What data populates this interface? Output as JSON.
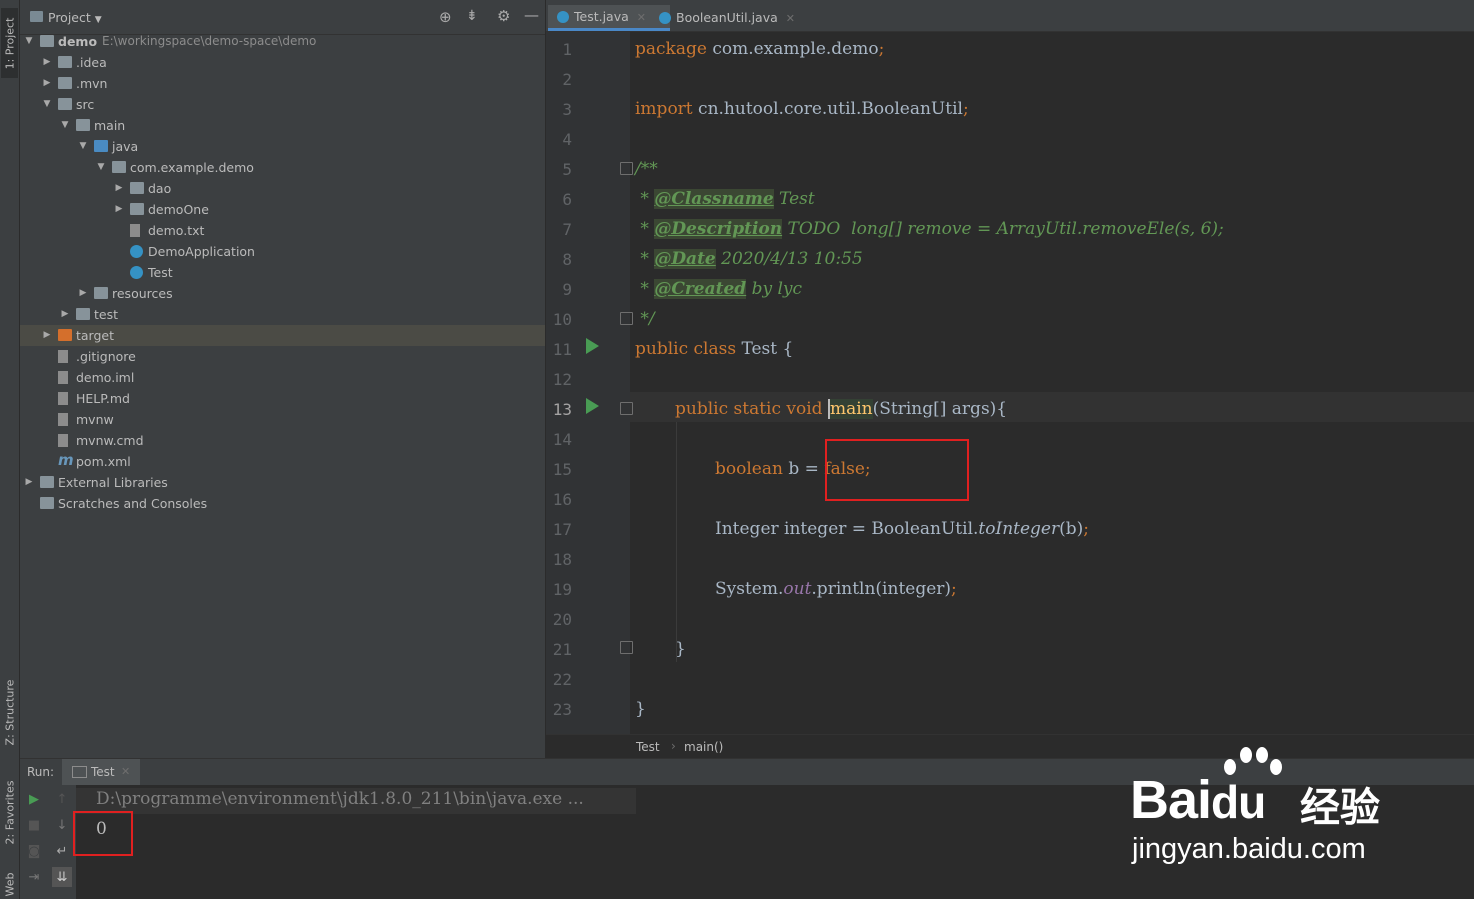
{
  "left_stripe": {
    "project_tab": "1: Project",
    "structure_tab": "Z: Structure",
    "favorites_tab": "2: Favorites",
    "web_tab": "Web"
  },
  "project_panel": {
    "title": "Project",
    "tree": [
      {
        "label": "demo",
        "path": "E:\\workingspace\\demo-space\\demo",
        "icon": "folder-icon"
      },
      {
        "label": ".idea",
        "icon": "folder-icon"
      },
      {
        "label": ".mvn",
        "icon": "folder-icon"
      },
      {
        "label": "src",
        "icon": "folder-icon"
      },
      {
        "label": "main",
        "icon": "folder-icon"
      },
      {
        "label": "java",
        "icon": "source-folder-icon"
      },
      {
        "label": "com.example.demo",
        "icon": "package-icon"
      },
      {
        "label": "dao",
        "icon": "package-icon"
      },
      {
        "label": "demoOne",
        "icon": "package-icon"
      },
      {
        "label": "demo.txt",
        "icon": "text-file-icon"
      },
      {
        "label": "DemoApplication",
        "icon": "class-icon"
      },
      {
        "label": "Test",
        "icon": "class-icon"
      },
      {
        "label": "resources",
        "icon": "resources-folder-icon"
      },
      {
        "label": "test",
        "icon": "folder-icon"
      },
      {
        "label": "target",
        "icon": "excluded-folder-icon"
      },
      {
        "label": ".gitignore",
        "icon": "text-file-icon"
      },
      {
        "label": "demo.iml",
        "icon": "module-file-icon"
      },
      {
        "label": "HELP.md",
        "icon": "markdown-file-icon"
      },
      {
        "label": "mvnw",
        "icon": "text-file-icon"
      },
      {
        "label": "mvnw.cmd",
        "icon": "text-file-icon"
      },
      {
        "label": "pom.xml",
        "icon": "maven-icon"
      },
      {
        "label": "External Libraries",
        "icon": "libraries-icon"
      },
      {
        "label": "Scratches and Consoles",
        "icon": "scratches-icon"
      }
    ]
  },
  "editor": {
    "tabs": [
      {
        "label": "Test.java"
      },
      {
        "label": "BooleanUtil.java"
      }
    ],
    "line_numbers": [
      "1",
      "2",
      "3",
      "4",
      "5",
      "6",
      "7",
      "8",
      "9",
      "10",
      "11",
      "12",
      "13",
      "14",
      "15",
      "16",
      "17",
      "18",
      "19",
      "20",
      "21",
      "22",
      "23"
    ],
    "code": {
      "l1_kw": "package",
      "l1_rest": " com.example.demo",
      "l1_semi": ";",
      "l3_kw": "import",
      "l3_rest": " cn.hutool.core.util.BooleanUtil",
      "l3_semi": ";",
      "l5": "/**",
      "l6_star": " * ",
      "l6_tag": "@Classname",
      "l6_rest": " Test",
      "l7_star": " * ",
      "l7_tag": "@Description",
      "l7_rest": " TODO  long[] remove = ArrayUtil.removeEle(s, 6);",
      "l8_star": " * ",
      "l8_tag": "@Date",
      "l8_rest": " 2020/4/13 10:55",
      "l9_star": " * ",
      "l9_tag": "@Created",
      "l9_rest": " by lyc",
      "l10": " */",
      "l11_kw": "public class",
      "l11_rest": " Test {",
      "l13_kw": "public static void",
      "l13_fn": "main",
      "l13_rest": "(String[] args){",
      "l15_kw": "boolean",
      "l15_rest": " b = ",
      "l15_val": "false;",
      "l17_a": "Integer integer = BooleanUtil.",
      "l17_m": "toInteger",
      "l17_b": "(b)",
      "l17_semi": ";",
      "l19_a": "System.",
      "l19_f": "out",
      "l19_b": ".println(integer)",
      "l19_semi": ";",
      "l21": "}",
      "l23": "}"
    },
    "breadcrumb": [
      "Test",
      "main()"
    ]
  },
  "run_panel": {
    "label": "Run:",
    "tab": "Test",
    "command": "D:\\programme\\environment\\jdk1.8.0_211\\bin\\java.exe ...",
    "output": "0"
  },
  "watermark": {
    "brand": "Bai",
    "brand2": "du",
    "cn": "经验",
    "url": "jingyan.baidu.com"
  },
  "colors": {
    "keyword": "#cc7832",
    "doc": "#629755",
    "highlight_box": "#e02020",
    "run_green": "#499c54"
  }
}
